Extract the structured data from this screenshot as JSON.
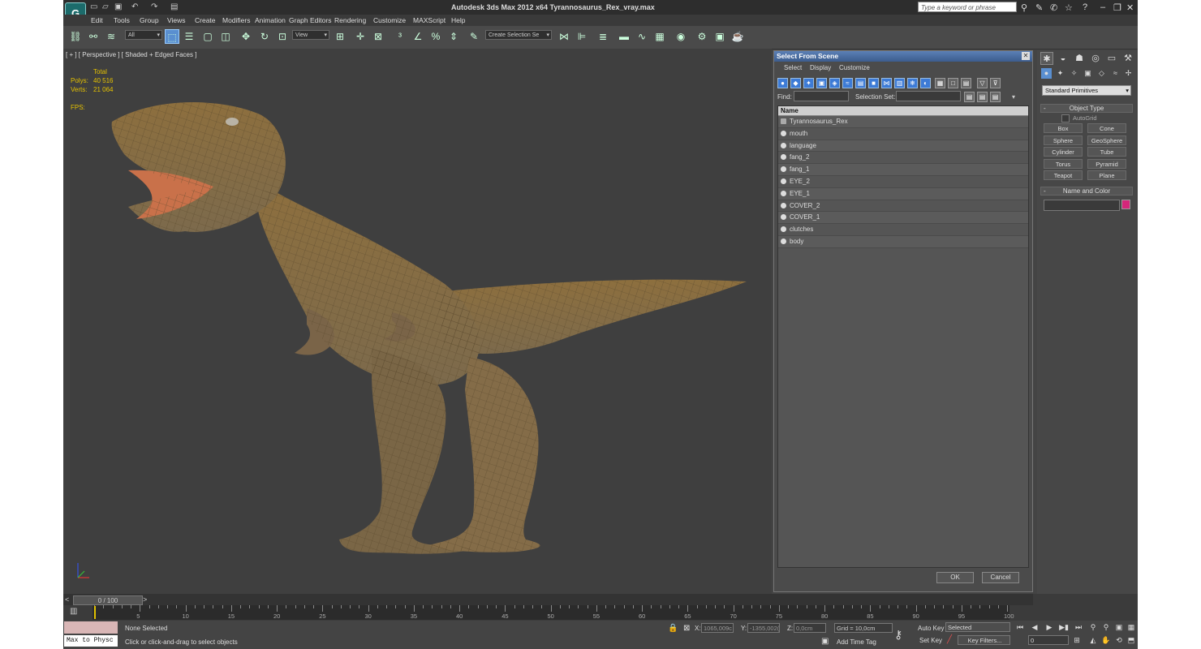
{
  "window": {
    "title": "Autodesk 3ds Max  2012 x64     Tyrannosaurus_Rex_vray.max",
    "search_placeholder": "Type a keyword or phrase"
  },
  "menu": [
    "Edit",
    "Tools",
    "Group",
    "Views",
    "Create",
    "Modifiers",
    "Animation",
    "Graph Editors",
    "Rendering",
    "Customize",
    "MAXScript",
    "Help"
  ],
  "toolbar": {
    "filter": "All",
    "ref_coord": "View",
    "selection_set": "Create Selection Se"
  },
  "viewport": {
    "label": "[ + ] [ Perspective ] [ Shaded + Edged Faces ]",
    "stats_header": "Total",
    "polys_label": "Polys:",
    "polys_value": "40 516",
    "verts_label": "Verts:",
    "verts_value": "21 064",
    "fps_label": "FPS:"
  },
  "dialog": {
    "title": "Select From Scene",
    "menu": [
      "Select",
      "Display",
      "Customize"
    ],
    "find_label": "Find:",
    "selection_set_label": "Selection Set:",
    "column_header": "Name",
    "objects": [
      "Tyrannosaurus_Rex",
      "mouth",
      "language",
      "fang_2",
      "fang_1",
      "EYE_2",
      "EYE_1",
      "COVER_2",
      "COVER_1",
      "clutches",
      "body"
    ],
    "ok_label": "OK",
    "cancel_label": "Cancel"
  },
  "command_panel": {
    "category": "Standard Primitives",
    "object_type_title": "Object Type",
    "autogrid_label": "AutoGrid",
    "primitives": [
      "Box",
      "Cone",
      "Sphere",
      "GeoSphere",
      "Cylinder",
      "Tube",
      "Torus",
      "Pyramid",
      "Teapot",
      "Plane"
    ],
    "name_color_title": "Name and Color",
    "object_color": "#d4267a"
  },
  "timeline": {
    "frame_display": "0 / 100",
    "ticks": [
      "5",
      "10",
      "15",
      "20",
      "25",
      "30",
      "35",
      "40",
      "45",
      "50",
      "55",
      "60",
      "65",
      "70",
      "75",
      "80",
      "85",
      "90",
      "95",
      "100"
    ]
  },
  "status": {
    "maxscript_text": "Max to Physc",
    "selection_status": "None Selected",
    "prompt": "Click or click-and-drag to select objects",
    "x_label": "X:",
    "x_value": "1065,009c",
    "y_label": "Y:",
    "y_value": "-1355,002(",
    "z_label": "Z:",
    "z_value": "0,0cm",
    "grid": "Grid = 10,0cm",
    "add_time_tag": "Add Time Tag",
    "auto_key": "Auto Key",
    "set_key": "Set Key",
    "key_mode": "Selected",
    "key_filters": "Key Filters...",
    "frame_field": "0"
  }
}
